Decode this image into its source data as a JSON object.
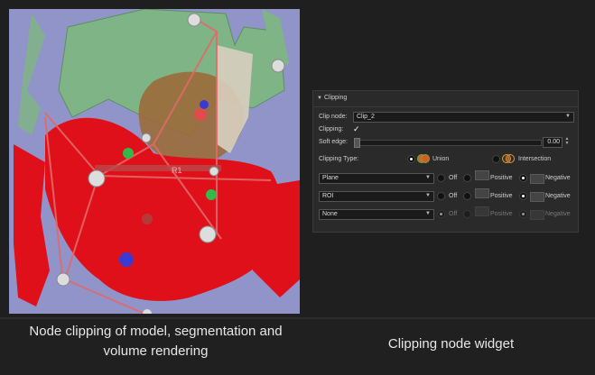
{
  "captions": {
    "left_line1": "Node clipping of model, segmentation and",
    "left_line2": "volume rendering",
    "right": "Clipping node widget"
  },
  "viewer": {
    "roi_label": "R1"
  },
  "panel": {
    "title": "Clipping",
    "clip_node_label": "Clip node:",
    "clip_node_value": "Clip_2",
    "clipping_label": "Clipping:",
    "clipping_checked": true,
    "soft_edge_label": "Soft edge:",
    "soft_edge_value": "0.00",
    "clipping_type_label": "Clipping Type:",
    "union_label": "Union",
    "intersection_label": "Intersection",
    "rows": [
      {
        "select": "Plane",
        "off": "Off",
        "positive": "Positive",
        "negative": "Negative",
        "selected": "negative"
      },
      {
        "select": "ROI",
        "off": "Off",
        "positive": "Positive",
        "negative": "Negative",
        "selected": "positive"
      },
      {
        "select": "None",
        "off": "Off",
        "positive": "Positive",
        "negative": "Negative",
        "selected": "positive"
      }
    ]
  },
  "colors": {
    "viewer_bg": "#9194c8",
    "segment_red": "#e0101a",
    "model_green": "#7fb486",
    "roi_lines": "#e06a6a",
    "panel_bg": "#2a2a2a"
  }
}
